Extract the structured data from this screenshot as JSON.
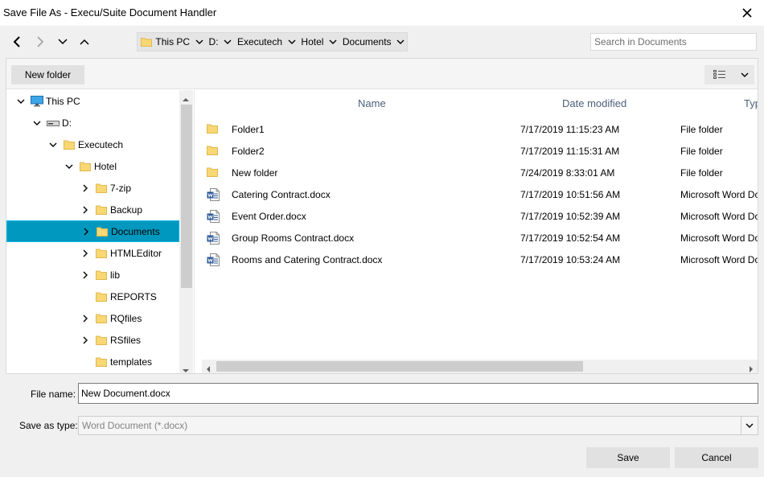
{
  "window": {
    "title": "Save File As - Execu/Suite Document Handler"
  },
  "nav": {
    "breadcrumbs": [
      "This PC",
      "D:",
      "Executech",
      "Hotel",
      "Documents"
    ],
    "search_placeholder": "Search in Documents"
  },
  "toolbar": {
    "new_folder_label": "New folder"
  },
  "tree": {
    "items": [
      {
        "label": "This PC",
        "depth": 0,
        "chevron": "down",
        "icon": "monitor-icon"
      },
      {
        "label": "D:",
        "depth": 1,
        "chevron": "down",
        "icon": "drive-icon"
      },
      {
        "label": "Executech",
        "depth": 2,
        "chevron": "down",
        "icon": "folder-icon"
      },
      {
        "label": "Hotel",
        "depth": 3,
        "chevron": "down",
        "icon": "folder-icon"
      },
      {
        "label": "7-zip",
        "depth": 4,
        "chevron": "right",
        "icon": "folder-icon"
      },
      {
        "label": "Backup",
        "depth": 4,
        "chevron": "right",
        "icon": "folder-icon"
      },
      {
        "label": "Documents",
        "depth": 4,
        "chevron": "right",
        "icon": "folder-icon",
        "selected": true
      },
      {
        "label": "HTMLEditor",
        "depth": 4,
        "chevron": "right",
        "icon": "folder-icon"
      },
      {
        "label": "lib",
        "depth": 4,
        "chevron": "right",
        "icon": "folder-icon"
      },
      {
        "label": "REPORTS",
        "depth": 4,
        "chevron": "none",
        "icon": "folder-icon"
      },
      {
        "label": "RQfiles",
        "depth": 4,
        "chevron": "right",
        "icon": "folder-icon"
      },
      {
        "label": "RSfiles",
        "depth": 4,
        "chevron": "right",
        "icon": "folder-icon"
      },
      {
        "label": "templates",
        "depth": 4,
        "chevron": "none",
        "icon": "folder-icon"
      }
    ]
  },
  "list": {
    "columns": {
      "name": "Name",
      "date": "Date modified",
      "type": "Typ"
    },
    "rows": [
      {
        "name": "Folder1",
        "date": "7/17/2019 11:15:23 AM",
        "type": "File folder",
        "icon": "folder-icon"
      },
      {
        "name": "Folder2",
        "date": "7/17/2019 11:15:31 AM",
        "type": "File folder",
        "icon": "folder-icon"
      },
      {
        "name": "New folder",
        "date": "7/24/2019 8:33:01 AM",
        "type": "File folder",
        "icon": "folder-icon"
      },
      {
        "name": "Catering Contract.docx",
        "date": "7/17/2019 10:51:56 AM",
        "type": "Microsoft Word Do",
        "icon": "word-doc-icon"
      },
      {
        "name": "Event Order.docx",
        "date": "7/17/2019 10:52:39 AM",
        "type": "Microsoft Word Do",
        "icon": "word-doc-icon"
      },
      {
        "name": "Group Rooms Contract.docx",
        "date": "7/17/2019 10:52:54 AM",
        "type": "Microsoft Word Do",
        "icon": "word-doc-icon"
      },
      {
        "name": "Rooms and Catering Contract.docx",
        "date": "7/17/2019 10:53:24 AM",
        "type": "Microsoft Word Do",
        "icon": "word-doc-icon"
      }
    ]
  },
  "form": {
    "filename_label": "File name:",
    "filename_value": "New Document.docx",
    "savetype_label": "Save as type:",
    "savetype_value": "Word Document (*.docx)"
  },
  "buttons": {
    "save": "Save",
    "cancel": "Cancel"
  },
  "colors": {
    "selection": "#0098be",
    "folder": "#f8d775",
    "word_blue": "#2b5797",
    "header_text": "#4c607a"
  }
}
